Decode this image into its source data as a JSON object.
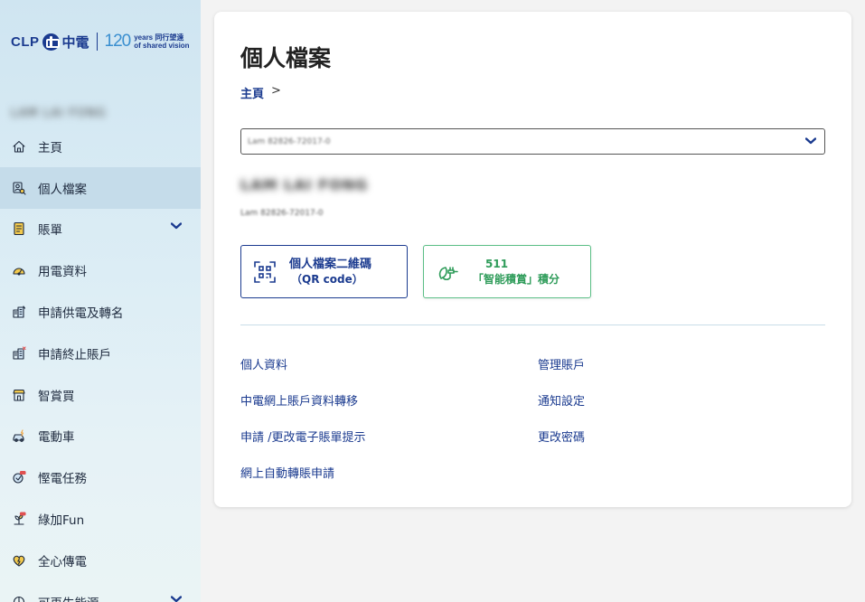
{
  "logo": {
    "brand": "CLP",
    "brand_cn": "中電",
    "anniv": "120",
    "tag_line1": "years 同行望遠",
    "tag_line2": "of shared vision"
  },
  "sidebar": {
    "user_name": "LAM LAI FONG",
    "items": [
      {
        "label": "主頁",
        "icon": "home-icon",
        "active": false,
        "expandable": false
      },
      {
        "label": "個人檔案",
        "icon": "profile-icon",
        "active": true,
        "expandable": false
      },
      {
        "label": "賬單",
        "icon": "bill-icon",
        "active": false,
        "expandable": true
      },
      {
        "label": "用電資料",
        "icon": "gauge-icon",
        "active": false,
        "expandable": false
      },
      {
        "label": "申請供電及轉名",
        "icon": "building-icon",
        "active": false,
        "expandable": false
      },
      {
        "label": "申請終止賬戶",
        "icon": "building-close-icon",
        "active": false,
        "expandable": false
      },
      {
        "label": "智賞買",
        "icon": "shop-icon",
        "active": false,
        "expandable": false
      },
      {
        "label": "電動車",
        "icon": "ev-car-icon",
        "active": false,
        "expandable": false
      },
      {
        "label": "慳電任務",
        "icon": "mission-icon",
        "active": false,
        "expandable": false
      },
      {
        "label": "綠加Fun",
        "icon": "green-plant-icon",
        "active": false,
        "expandable": false
      },
      {
        "label": "全心傳電",
        "icon": "heart-power-icon",
        "active": false,
        "expandable": false
      },
      {
        "label": "可再生能源",
        "icon": "renewable-icon",
        "active": false,
        "expandable": true
      }
    ]
  },
  "main": {
    "title": "個人檔案",
    "breadcrumb": {
      "home": "主頁",
      "sep": ">"
    },
    "account_select": {
      "value": "Lam 82826-72017-0"
    },
    "profile": {
      "name": "LAM LAI FONG",
      "account": "Lam 82826-72017-0"
    },
    "qr_button": {
      "line1": "個人檔案二維碼",
      "line2": "（QR code）"
    },
    "points_button": {
      "points": "511",
      "label": "「智能積賞」積分"
    },
    "links": {
      "left": [
        "個人資料",
        "中電網上賬戶資料轉移",
        "申請 /更改電子賬單提示",
        "網上自動轉賬申請"
      ],
      "right": [
        "管理賬戶",
        "通知設定",
        "更改密碼"
      ]
    }
  },
  "colors": {
    "brand_blue": "#1a3a8f",
    "green": "#2f9c5a",
    "green_border": "#5bbf86",
    "active_nav": "#c5dcea"
  }
}
